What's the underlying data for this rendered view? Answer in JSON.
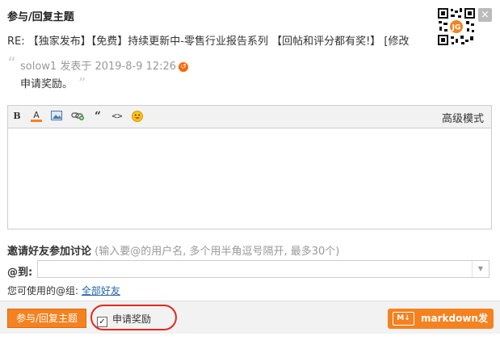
{
  "dialog": {
    "title": "参与/回复主题",
    "close_label": "×",
    "qr_logo": "JG"
  },
  "subject": "RE: 【独家发布】【免费】持续更新中-零售行业报告系列 【回帖和评分都有奖!】 [修改",
  "quote": {
    "open_mark": "“",
    "meta": "solow1 发表于 2019-8-9 12:26",
    "jump_icon": "↺",
    "text": "申请奖励。",
    "close_mark": "”"
  },
  "toolbar": {
    "bold": "B",
    "font_color": "A",
    "image": "image-icon",
    "link": "link-icon",
    "quote": "“",
    "code": "<>",
    "smiley": "smiley-icon",
    "advanced_mode": "高级模式"
  },
  "invite": {
    "title": "邀请好友参加讨论",
    "hint": "(输入要@的用户名, 多个用半角逗号隔开, 最多30个)",
    "at_label": "@到:",
    "groups_text": "您可使用的@组:",
    "groups_link": "全部好友"
  },
  "footer": {
    "submit_label": "参与/回复主题",
    "reward_label": "申请奖励",
    "reward_checked": "✓",
    "markdown_icon": "M↓",
    "markdown_label": "markdown发帖"
  },
  "colors": {
    "accent": "#f5821f",
    "highlight": "#e3281f",
    "link": "#2366a8"
  }
}
